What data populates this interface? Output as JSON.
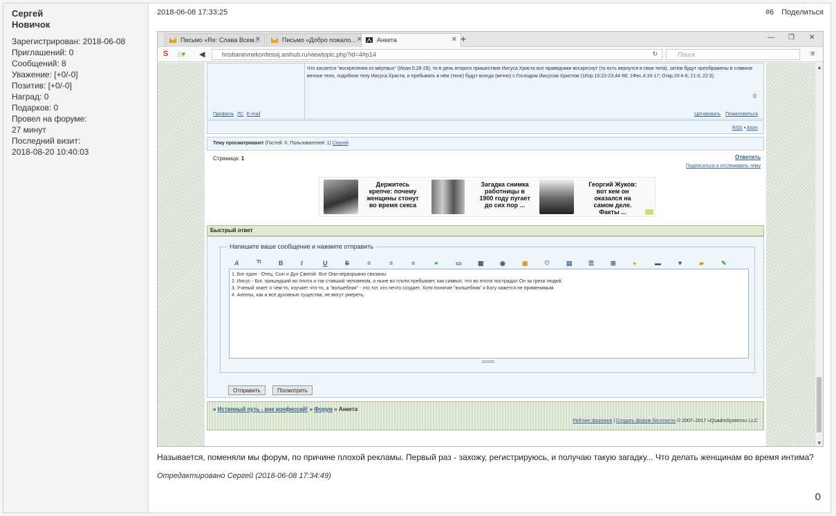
{
  "profile": {
    "name": "Сергей",
    "rank": "Новичок",
    "stats": [
      "Зарегистрирован: 2018-06-08",
      "Приглашений: 0",
      "Сообщений: 8",
      "Уважение: [+0/-0]",
      "Позитив: [+0/-0]",
      "Наград: 0",
      "Подарков: 0",
      "Провел на форуме:",
      "27 минут",
      "Последний визит:",
      "2018-08-20 10:40:03"
    ]
  },
  "post": {
    "date": "2018-06-08 17:33:25",
    "number": "#6",
    "share": "Поделиться",
    "text": "Называется, поменяли мы форум, по причине плохой рекламы. Первый раз - захожу, регистрируюсь, и получаю такую загадку... Что делать женщинам во время интима?",
    "edited": "Отредактировано Сергей (2018-06-08 17:34:49)",
    "likes": "0"
  },
  "browser": {
    "tabs": [
      "Письмо «Re: Слава Всем...",
      "Письмо «Добро пожало...",
      "Анкета"
    ],
    "url": "hristianevnekonfessij.anihub.ru/viewtopic.php?id=4#p14",
    "search_placeholder": "Поиск",
    "colors": {
      "mail_icon": "#e8a020",
      "tab_close": "#555555"
    }
  },
  "forum": {
    "quote": "Что касается \"воскресения из мёртвых\" (Иоан.5:28-29), то в день второго пришествия Иисуса Христа все праведники воскреснут (то есть вернутся в свои тела), затем будут преображены в славное вечное тело, подобное телу Иисуса Христа, и пребывать в нём (теле) будут всегда (вечно) с Господом Иисусом Христом (1Кор.15:22-23,44-58; 1Фес.4:16-17; Откр.20:4-6; 21:3; 22:3).",
    "quote_count": "0",
    "profile_links": [
      "Профиль",
      "ЛС",
      "E-mail"
    ],
    "post_links": [
      "Цитировать",
      "Пожаловаться"
    ],
    "rss": "RSS",
    "atom": "Atom",
    "viewing_label": "Тему просматривают",
    "viewing_info": "(Гостей: 0, Пользователей: 1)",
    "viewing_user": "Сергей",
    "page_label": "Страница:",
    "page_num": "1",
    "reply": "Ответить",
    "subscribe": "Подписаться и отслеживать тему",
    "ads": [
      "Держитесь крепче: почему женщины стонут во время секса",
      "Загадка снимка работницы в 1900 году пугает до сих пор ...",
      "Георгий Жуков: вот кем он оказался на самом деле. Факты ..."
    ],
    "quick_reply": "Быстрый ответ",
    "fieldset_legend": "Напишите ваше сообщение и нажмите отправить",
    "editor_lines": [
      "1. Бог един - Отец, Сын и Дух Святой. Все Они неразрывно связаны.",
      "2. Иисус - Бог, пришедший во плоти и так ставший человеком, и ныне во плоти пребывает, как символ, что во плоти пострадал Он за грехи людей.",
      "3. Ученый знает о чем-то, изучает что-то, а \"волшебник\" - это тот, кто нечто создает. Хотя понятие \"волшебник\" к Богу кажется не применимым.",
      "4. Ангелы, как и все духовные существа, не могут умереть."
    ],
    "send": "Отправить",
    "preview": "Посмотреть",
    "crumb1": "Истинный путь - вне конфессий!",
    "crumb2": "Форум",
    "crumb3": "Анкета",
    "footer_links": [
      "Рейтинг форумов",
      "Создать форум бесплатно"
    ],
    "copyright": "© 2007–2017 «QuadroSystems» LLC"
  }
}
